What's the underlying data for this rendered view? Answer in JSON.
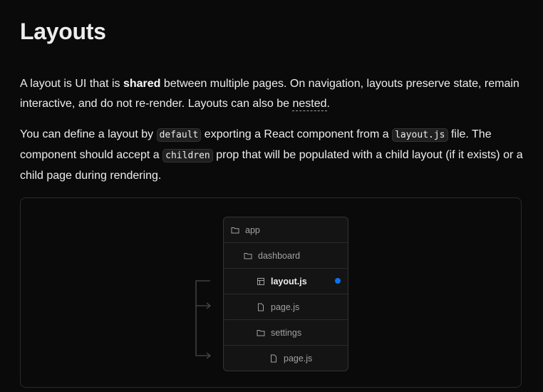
{
  "title": "Layouts",
  "para1": {
    "pre": "A layout is UI that is ",
    "bold": "shared",
    "mid": " between multiple pages. On navigation, layouts preserve state, remain interactive, and do not re-render. Layouts can also be ",
    "link": "nested",
    "post": "."
  },
  "para2": {
    "t1": "You can define a layout by ",
    "c1": "default",
    "t2": " exporting a React component from a ",
    "c2": "layout.js",
    "t3": " file. The component should accept a ",
    "c3": "children",
    "t4": " prop that will be populated with a child layout (if it exists) or a child page during rendering."
  },
  "tree": [
    {
      "label": "app",
      "icon": "folder-icon",
      "indent": 0
    },
    {
      "label": "dashboard",
      "icon": "folder-icon",
      "indent": 1
    },
    {
      "label": "layout.js",
      "icon": "layout-file-icon",
      "indent": 2,
      "active": true
    },
    {
      "label": "page.js",
      "icon": "file-icon",
      "indent": 2
    },
    {
      "label": "settings",
      "icon": "folder-icon",
      "indent": 2
    },
    {
      "label": "page.js",
      "icon": "file-icon",
      "indent": 3
    }
  ],
  "colors": {
    "accent": "#0a72ef",
    "background": "#0a0a0a"
  }
}
